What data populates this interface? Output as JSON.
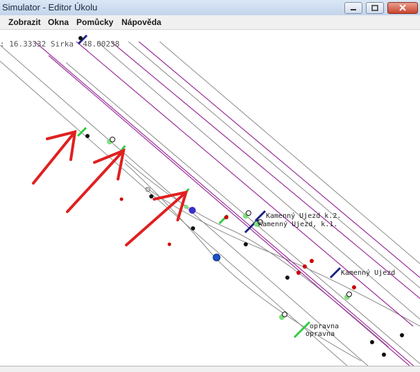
{
  "window": {
    "title": "Simulator - Editor Úkolu"
  },
  "menu": {
    "items": [
      "Zobrazit",
      "Okna",
      "Pomůcky",
      "Nápověda"
    ]
  },
  "coords": {
    "text": ": 16.33332 Sirka  48.00238"
  },
  "labels": {
    "stop1": "Kamenný Ujezd  k.2.",
    "stop2": "Kamenný Ujezd, k.1.",
    "stop3": "Kamenný Ujezd",
    "depot1": "opravna",
    "depot2": "opravna"
  },
  "colors": {
    "track": "#9a2f9a",
    "line": "#8a8a8a",
    "arrow": "#e02020"
  }
}
